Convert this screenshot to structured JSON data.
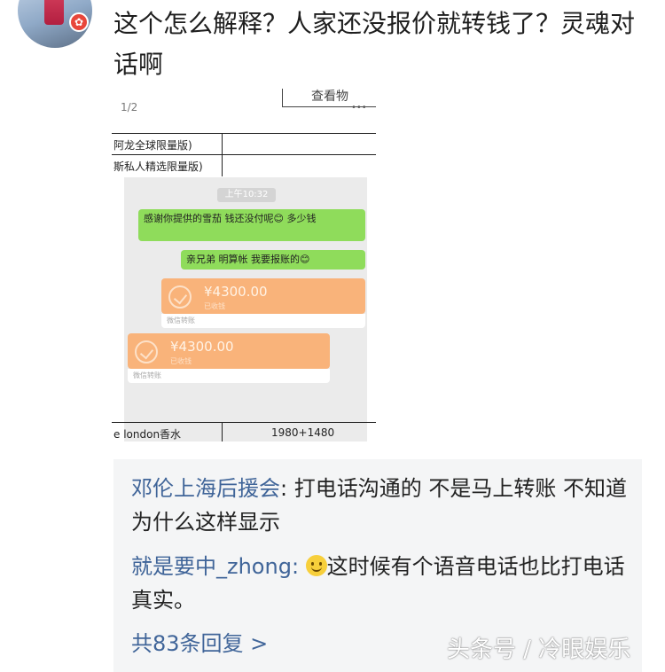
{
  "post": {
    "text": "这个怎么解释？人家还没报价就转钱了？灵魂对话啊"
  },
  "screenshot": {
    "pager": "1/2",
    "view_button": "查看物",
    "dots": "•••",
    "table_rows": [
      "阿龙全球限量版)",
      "斯私人精选限量版)"
    ],
    "time": "上午10:32",
    "msg1": "感谢你提供的雪茄 钱还没付呢😊 多少钱",
    "msg2": "亲兄弟 明算帐 我要报账的😊",
    "transfer1": {
      "amount": "¥4300.00",
      "sub": "已收钱",
      "foot": "微信转账"
    },
    "transfer2": {
      "amount": "¥4300.00",
      "sub": "已收钱",
      "foot": "微信转账"
    },
    "bottom_left": "e london香水",
    "bottom_right": "1980+1480"
  },
  "replies": [
    {
      "author": "邓伦上海后援会",
      "text": ": 打电话沟通的 不是马上转账 不知道为什么这样显示"
    },
    {
      "author": "就是要中_zhong",
      "text": "这时候有个语音电话也比打电话真实。"
    }
  ],
  "more_replies": "共83条回复 >",
  "watermark": "头条号 / 冷眼娱乐"
}
